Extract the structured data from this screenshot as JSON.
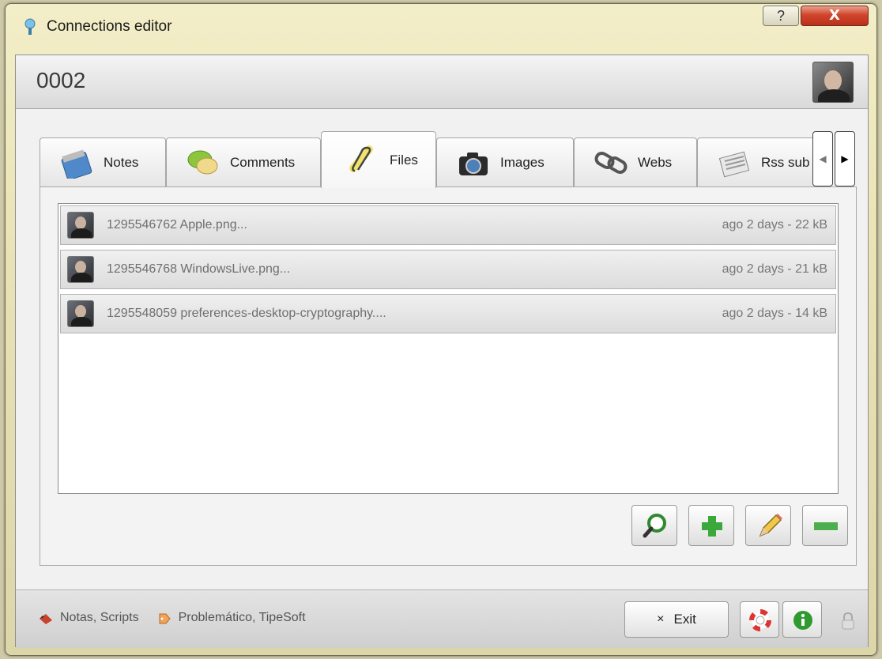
{
  "window": {
    "title": "Connections editor",
    "help_glyph": "?",
    "close_glyph": "X"
  },
  "header": {
    "record_id": "0002"
  },
  "tabs": [
    {
      "label": "Notes",
      "icon": "notepad-icon"
    },
    {
      "label": "Comments",
      "icon": "speech-bubbles-icon"
    },
    {
      "label": "Files",
      "icon": "paperclip-icon",
      "active": true
    },
    {
      "label": "Images",
      "icon": "camera-icon"
    },
    {
      "label": "Webs",
      "icon": "chain-link-icon"
    },
    {
      "label": "Rss sub",
      "icon": "newspaper-icon"
    }
  ],
  "tab_scroll": {
    "left_glyph": "◀",
    "right_glyph": "▶"
  },
  "files": [
    {
      "name": "1295546762 Apple.png...",
      "meta": "ago 2 days - 22 kB"
    },
    {
      "name": "1295546768 WindowsLive.png...",
      "meta": "ago 2 days - 21 kB"
    },
    {
      "name": "1295548059 preferences-desktop-cryptography....",
      "meta": "ago 2 days - 14 kB"
    }
  ],
  "actions": [
    "search-icon",
    "add-icon",
    "edit-icon",
    "remove-icon"
  ],
  "footer": {
    "tags_label_1": "Notas, Scripts",
    "tags_label_2": "Problemático, TipeSoft",
    "exit_glyph": "×",
    "exit_label": "Exit"
  },
  "colors": {
    "add_green": "#3aa83a",
    "remove_green": "#4cae4c",
    "info_green": "#2f9a2f",
    "close_red": "#c9402a"
  }
}
